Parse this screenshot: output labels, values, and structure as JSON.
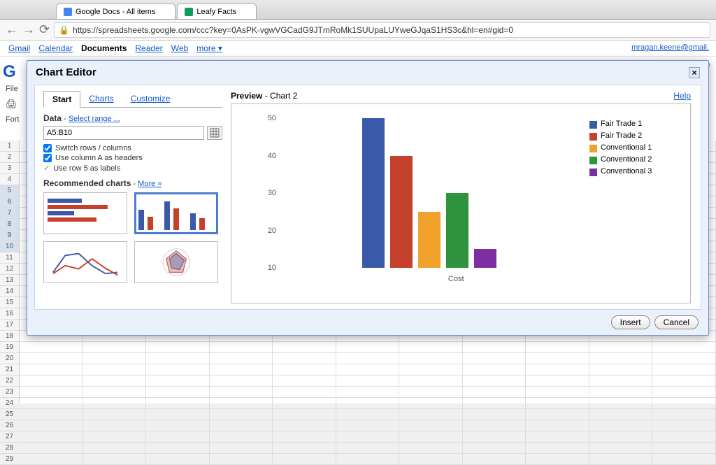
{
  "browser": {
    "tabs": [
      {
        "title": "Google Docs - All items"
      },
      {
        "title": "Leafy Facts"
      }
    ],
    "url": "https://spreadsheets.google.com/ccc?key=0AsPK-vgwVGCadG9JTmRoMk1SUUpaLUYweGJqaS1HS3c&hl=en#gid=0"
  },
  "gbar": {
    "links": [
      "Gmail",
      "Calendar",
      "Documents",
      "Reader",
      "Web",
      "more"
    ],
    "selected_index": 2,
    "user_email": "mragan.keene@gmail."
  },
  "sheet": {
    "menu_left": [
      "File",
      "Fort"
    ],
    "logo_snip": "G",
    "row_start": 1,
    "row_end": 29,
    "selected_rows": [
      5,
      6,
      7,
      8,
      9,
      10
    ]
  },
  "dialog": {
    "title": "Chart Editor",
    "tabs": [
      "Start",
      "Charts",
      "Customize"
    ],
    "active_tab": 0,
    "data_label": "Data",
    "select_range": "Select range ...",
    "range_value": "A5:B10",
    "opt_switch": "Switch rows / columns",
    "opt_colA": "Use column A as headers",
    "opt_row5": "Use row 5 as labels",
    "rec_label": "Recommended charts",
    "more": "More »",
    "preview_label": "Preview",
    "preview_name": "Chart 2",
    "help": "Help",
    "insert": "Insert",
    "cancel": "Cancel"
  },
  "chart_data": {
    "type": "bar",
    "categories": [
      "Fair Trade 1",
      "Fair Trade 2",
      "Conventional 1",
      "Conventional 2",
      "Conventional 3"
    ],
    "values": [
      50,
      40,
      25,
      30,
      15
    ],
    "colors": [
      "#3a59a8",
      "#c5412b",
      "#f0a22d",
      "#2f933d",
      "#7b2fa0"
    ],
    "xlabel": "Cost",
    "ylabel": "",
    "ylim": [
      10,
      50
    ],
    "yticks": [
      10,
      20,
      30,
      40,
      50
    ]
  }
}
